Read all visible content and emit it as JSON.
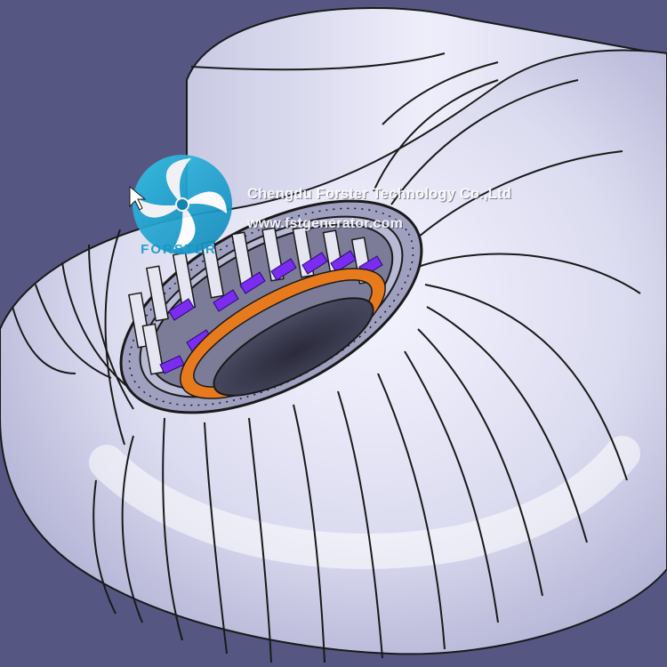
{
  "watermark": {
    "company": "Chengdu Forster Technology Co.,Ltd",
    "website": "www.fstgenerator.com",
    "logo_text": "FORSTER",
    "logo_color": "#1ea5d6"
  },
  "colors": {
    "background": "#565683",
    "casing": "#dcdcf0",
    "outline": "#1a1a1a",
    "guide_vanes": "#7a2cf0",
    "ring_band": "#e87a1e",
    "inner_opening": "#3a3a4c"
  },
  "icons": [
    "turbine-logo-icon",
    "cursor-arrow-icon"
  ]
}
